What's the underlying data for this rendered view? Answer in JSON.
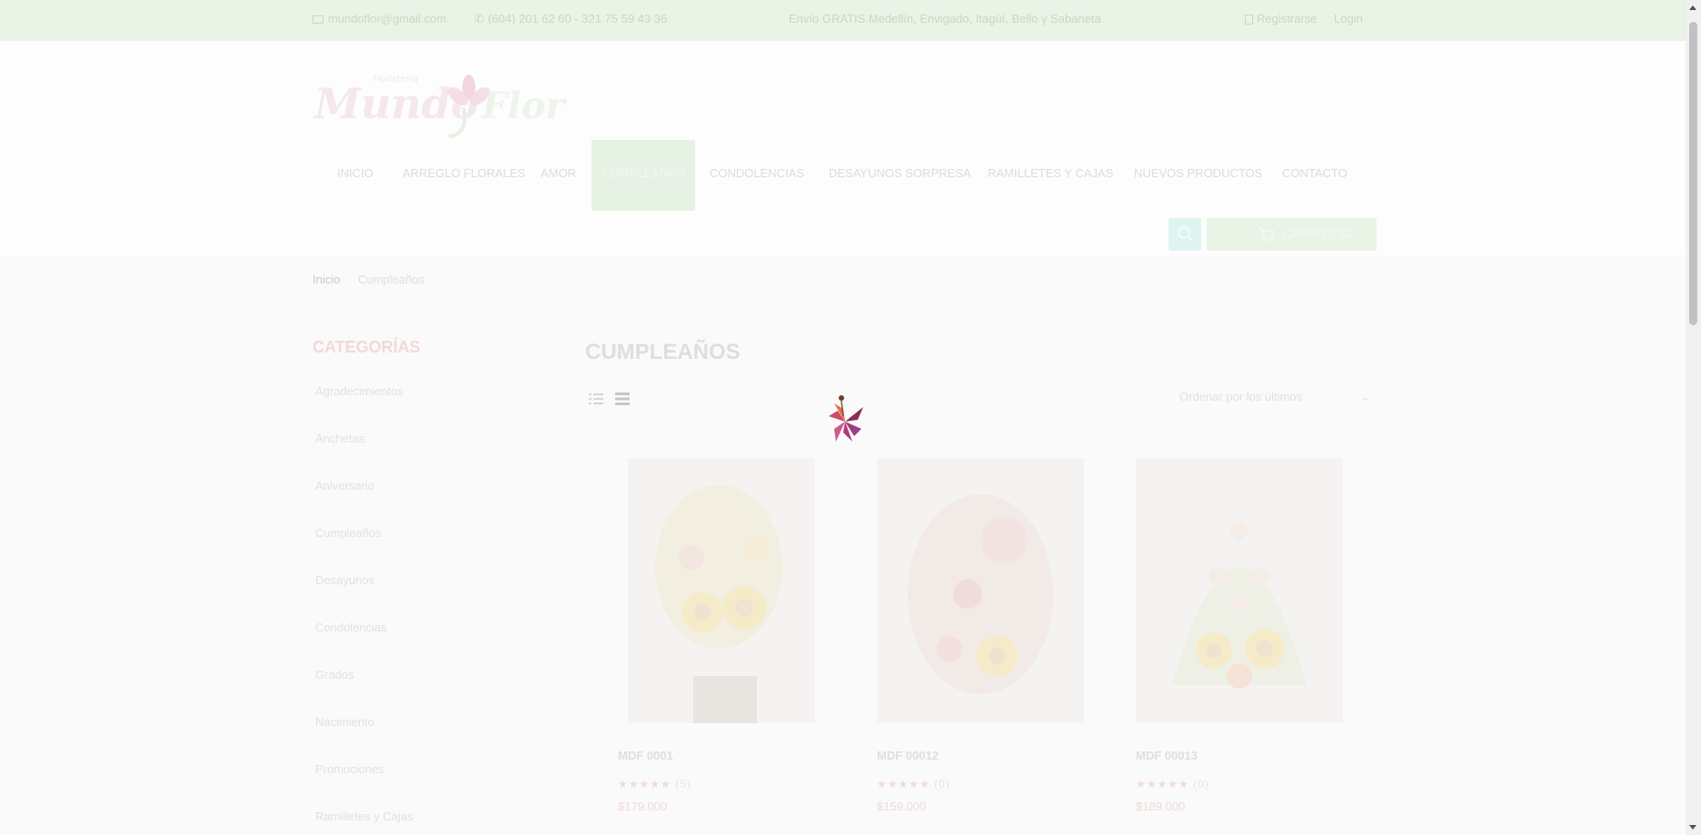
{
  "topbar": {
    "email": "mundoflor@gmail.com",
    "phones": "(604) 201 62 60 - 321 75 59 43 36",
    "shipping_notice": "Envío GRATIS Medellín, Envigado, Itagüí, Bello y Sabaneta",
    "register_label": "Registrarse",
    "login_label": "Login"
  },
  "nav": {
    "items": [
      "INICIO",
      "ARREGLO FLORALES",
      "AMOR",
      "CUMPLEAÑOS",
      "CONDOLENCIAS",
      "DESAYUNOS SORPRESA",
      "RAMILLETES Y CAJAS",
      "NUEVOS PRODUCTOS",
      "CONTACTO"
    ],
    "active_index": 3
  },
  "cart": {
    "label": "CARRITO $0"
  },
  "breadcrumb": {
    "home": "Inicio",
    "current": "Cumpleaños"
  },
  "sidebar": {
    "title": "CATEGORÍAS",
    "categories": [
      "Agradecimientos",
      "Anchetas",
      "Aniversario",
      "Cumpleaños",
      "Desayunos",
      "Condolencias",
      "Grados",
      "Nacimiento",
      "Promociones",
      "Ramilletes y Cajas"
    ]
  },
  "main": {
    "title": "CUMPLEAÑOS",
    "sort_selected": "Ordenar por los últimos"
  },
  "products": [
    {
      "name": "MDF 0001",
      "rating": "★★★★★",
      "reviews": "(5)",
      "price": "$179.000"
    },
    {
      "name": "MDF 00012",
      "rating": "★★★★★",
      "reviews": "(0)",
      "price": "$159.000"
    },
    {
      "name": "MDF 00013",
      "rating": "★★★★★",
      "reviews": "(0)",
      "price": "$189.000"
    }
  ],
  "colors": {
    "brand_green": "#e9f3e6",
    "accent_pink": "#f2d8d9",
    "search_teal": "#dff4f1"
  },
  "icons": {
    "email": "envelope-icon",
    "phone": "phone-icon",
    "register": "user-icon",
    "search": "search-icon",
    "cart": "cart-icon",
    "grid_view": "grid-view-icon",
    "list_view": "list-view-icon",
    "loader": "flower-loader-icon"
  }
}
